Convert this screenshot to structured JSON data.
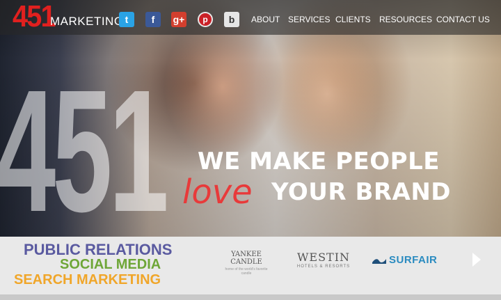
{
  "brand": {
    "logo_number": "451",
    "logo_word": "MARKETING"
  },
  "social": [
    {
      "icon": "twitter-icon",
      "glyph": "t"
    },
    {
      "icon": "facebook-icon",
      "glyph": "f"
    },
    {
      "icon": "google-plus-icon",
      "glyph": "g+"
    },
    {
      "icon": "pinterest-icon",
      "glyph": "p"
    },
    {
      "icon": "blog-icon",
      "glyph": "b"
    }
  ],
  "nav": [
    "ABOUT",
    "SERVICES",
    "CLIENTS",
    "RESOURCES",
    "CONTACT US"
  ],
  "hero": {
    "big_number": "451",
    "tagline_line1": "WE MAKE PEOPLE",
    "tagline_love": "love",
    "tagline_line2": "YOUR BRAND"
  },
  "services": [
    "PUBLIC RELATIONS",
    "SOCIAL MEDIA",
    "SEARCH MARKETING"
  ],
  "clients": {
    "yankee_name_1": "YANKEE",
    "yankee_name_2": "CANDLE",
    "yankee_sub": "home of the world's favorite candle",
    "westin_name": "WESTIN",
    "westin_sub": "HOTELS & RESORTS",
    "surfair_name": "SURFAIR"
  },
  "colors": {
    "logo_red": "#e0201f",
    "love_red": "#e83a3a",
    "public_relations": "#5a5aa0",
    "social_media": "#6ea637",
    "search_marketing": "#f0a62a"
  }
}
